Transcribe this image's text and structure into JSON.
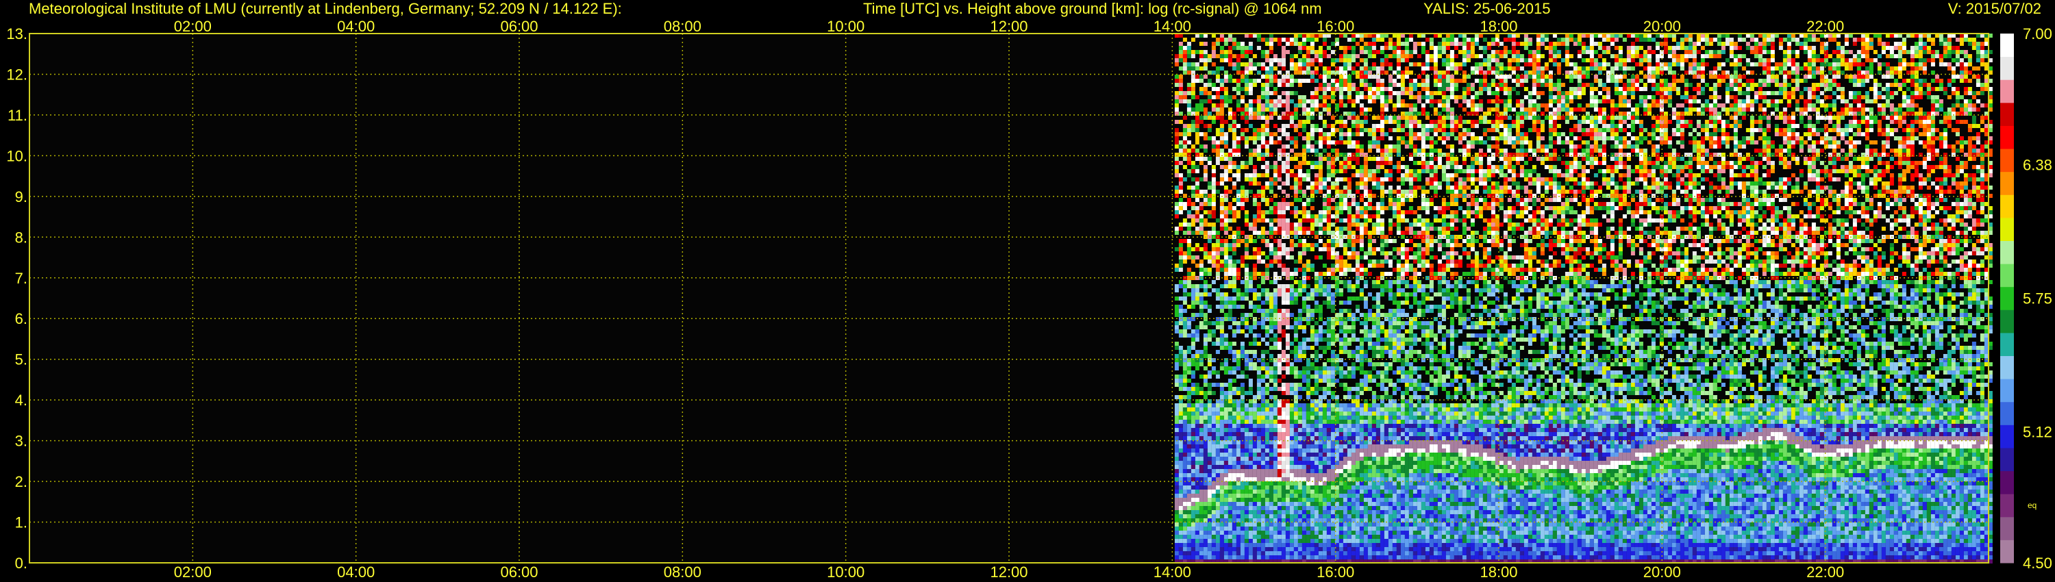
{
  "header": {
    "left": "Meteorological Institute of LMU (currently at Lindenberg, Germany; 52.209 N / 14.122 E):",
    "middle": "Time [UTC] vs. Height above ground [km]: log (rc-signal) @ 1064 nm",
    "date": "YALIS: 25-06-2015",
    "version": "V: 2015/07/02"
  },
  "chart_data": {
    "type": "heatmap",
    "title": "Time [UTC] vs. Height above ground [km]: log (rc-signal) @ 1064 nm",
    "xlabel": "Time [UTC]",
    "ylabel": "Height above ground [km]",
    "x_unit": "UTC hours",
    "xlim": [
      0,
      24
    ],
    "ylim": [
      0,
      13
    ],
    "x_ticks": [
      2,
      4,
      6,
      8,
      10,
      12,
      14,
      16,
      18,
      20,
      22
    ],
    "x_tick_labels": [
      "02:00",
      "04:00",
      "06:00",
      "08:00",
      "10:00",
      "12:00",
      "14:00",
      "16:00",
      "18:00",
      "20:00",
      "22:00"
    ],
    "y_ticks": [
      0,
      1,
      2,
      3,
      4,
      5,
      6,
      7,
      8,
      9,
      10,
      11,
      12,
      13
    ],
    "y_tick_labels": [
      "0.",
      "1.",
      "2.",
      "3.",
      "4.",
      "5.",
      "6.",
      "7.",
      "8.",
      "9.",
      "10.",
      "11.",
      "12.",
      "13."
    ],
    "grid": true,
    "data_start_time": 14.03,
    "data_end_time": 24.0,
    "colorbar": {
      "min": 4.5,
      "max": 7.0,
      "tick_labels": [
        "7.00",
        "6.38",
        "5.75",
        "5.12",
        "4.50"
      ],
      "tick_values": [
        7.0,
        6.38,
        5.75,
        5.12,
        4.5
      ],
      "extra_label": "eq",
      "colors": [
        "#a87fa0",
        "#8e5a8a",
        "#7a2a78",
        "#5a0a6a",
        "#2a1aa0",
        "#2020e0",
        "#3a6ae0",
        "#60a0f0",
        "#90c8f0",
        "#20b0a0",
        "#108a30",
        "#20c020",
        "#70e060",
        "#b0f0a0",
        "#e0f000",
        "#ffd000",
        "#ff9000",
        "#ff5000",
        "#ff0000",
        "#d00000",
        "#f090a0",
        "#e8e8e8",
        "#ffffff"
      ]
    },
    "features": {
      "cloud_top_layer_km": [
        {
          "t": 14.05,
          "h": 1.4
        },
        {
          "t": 14.4,
          "h": 1.7
        },
        {
          "t": 14.7,
          "h": 2.2
        },
        {
          "t": 15.0,
          "h": 2.1
        },
        {
          "t": 15.4,
          "h": 2.2
        },
        {
          "t": 15.8,
          "h": 2.0
        },
        {
          "t": 16.3,
          "h": 2.7
        },
        {
          "t": 16.8,
          "h": 2.8
        },
        {
          "t": 17.3,
          "h": 2.9
        },
        {
          "t": 17.8,
          "h": 2.7
        },
        {
          "t": 18.2,
          "h": 2.4
        },
        {
          "t": 18.6,
          "h": 2.5
        },
        {
          "t": 19.1,
          "h": 2.3
        },
        {
          "t": 20.2,
          "h": 3.0
        },
        {
          "t": 20.8,
          "h": 2.9
        },
        {
          "t": 21.4,
          "h": 3.2
        },
        {
          "t": 21.9,
          "h": 2.7
        },
        {
          "t": 22.3,
          "h": 2.8
        },
        {
          "t": 22.7,
          "h": 3.0
        }
      ],
      "vertical_streak_time": 15.35,
      "high_cloud_region": {
        "t_start": 22.6,
        "t_end": 24.0,
        "h_start": 9.0,
        "h_end": 11.0
      }
    }
  }
}
